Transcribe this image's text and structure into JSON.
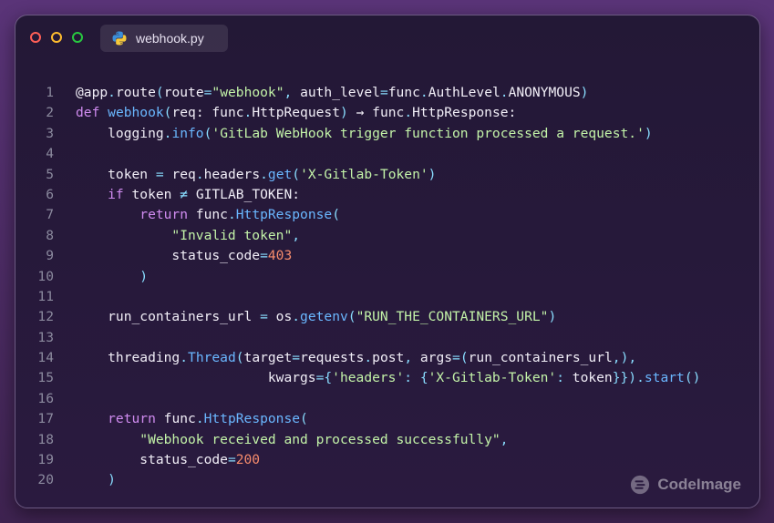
{
  "window": {
    "tab": {
      "icon": "python-icon",
      "filename": "webhook.py"
    }
  },
  "code": {
    "lines": [
      {
        "n": "1",
        "tokens": [
          [
            "t",
            "@app"
          ],
          [
            "o",
            "."
          ],
          [
            "t",
            "route"
          ],
          [
            "o",
            "("
          ],
          [
            "t",
            "route"
          ],
          [
            "o",
            "="
          ],
          [
            "s",
            "\"webhook\""
          ],
          [
            "o",
            ", "
          ],
          [
            "t",
            "auth_level"
          ],
          [
            "o",
            "="
          ],
          [
            "t",
            "func"
          ],
          [
            "o",
            "."
          ],
          [
            "t",
            "AuthLevel"
          ],
          [
            "o",
            "."
          ],
          [
            "t",
            "ANONYMOUS"
          ],
          [
            "o",
            ")"
          ]
        ]
      },
      {
        "n": "2",
        "tokens": [
          [
            "k",
            "def "
          ],
          [
            "f",
            "webhook"
          ],
          [
            "o",
            "("
          ],
          [
            "t",
            "req: func"
          ],
          [
            "o",
            "."
          ],
          [
            "t",
            "HttpRequest"
          ],
          [
            "o",
            ")"
          ],
          [
            "t",
            " → func"
          ],
          [
            "o",
            "."
          ],
          [
            "t",
            "HttpResponse:"
          ]
        ]
      },
      {
        "n": "3",
        "tokens": [
          [
            "t",
            "    logging"
          ],
          [
            "o",
            "."
          ],
          [
            "f",
            "info"
          ],
          [
            "o",
            "("
          ],
          [
            "s",
            "'GitLab WebHook trigger function processed a request.'"
          ],
          [
            "o",
            ")"
          ]
        ]
      },
      {
        "n": "4",
        "tokens": []
      },
      {
        "n": "5",
        "tokens": [
          [
            "t",
            "    token "
          ],
          [
            "o",
            "= "
          ],
          [
            "t",
            "req"
          ],
          [
            "o",
            "."
          ],
          [
            "t",
            "headers"
          ],
          [
            "o",
            "."
          ],
          [
            "f",
            "get"
          ],
          [
            "o",
            "("
          ],
          [
            "s",
            "'X-Gitlab-Token'"
          ],
          [
            "o",
            ")"
          ]
        ]
      },
      {
        "n": "6",
        "tokens": [
          [
            "k",
            "    if "
          ],
          [
            "t",
            "token "
          ],
          [
            "o",
            "≠ "
          ],
          [
            "t",
            "GITLAB_TOKEN:"
          ]
        ]
      },
      {
        "n": "7",
        "tokens": [
          [
            "k",
            "        return "
          ],
          [
            "t",
            "func"
          ],
          [
            "o",
            "."
          ],
          [
            "f",
            "HttpResponse"
          ],
          [
            "o",
            "("
          ]
        ]
      },
      {
        "n": "8",
        "tokens": [
          [
            "s",
            "            \"Invalid token\""
          ],
          [
            "o",
            ","
          ]
        ]
      },
      {
        "n": "9",
        "tokens": [
          [
            "t",
            "            status_code"
          ],
          [
            "o",
            "="
          ],
          [
            "n",
            "403"
          ]
        ]
      },
      {
        "n": "10",
        "tokens": [
          [
            "o",
            "        )"
          ]
        ]
      },
      {
        "n": "11",
        "tokens": []
      },
      {
        "n": "12",
        "tokens": [
          [
            "t",
            "    run_containers_url "
          ],
          [
            "o",
            "= "
          ],
          [
            "t",
            "os"
          ],
          [
            "o",
            "."
          ],
          [
            "f",
            "getenv"
          ],
          [
            "o",
            "("
          ],
          [
            "s",
            "\"RUN_THE_CONTAINERS_URL\""
          ],
          [
            "o",
            ")"
          ]
        ]
      },
      {
        "n": "13",
        "tokens": []
      },
      {
        "n": "14",
        "tokens": [
          [
            "t",
            "    threading"
          ],
          [
            "o",
            "."
          ],
          [
            "f",
            "Thread"
          ],
          [
            "o",
            "("
          ],
          [
            "t",
            "target"
          ],
          [
            "o",
            "="
          ],
          [
            "t",
            "requests"
          ],
          [
            "o",
            "."
          ],
          [
            "t",
            "post"
          ],
          [
            "o",
            ", "
          ],
          [
            "t",
            "args"
          ],
          [
            "o",
            "=("
          ],
          [
            "t",
            "run_containers_url"
          ],
          [
            "o",
            ",),"
          ]
        ]
      },
      {
        "n": "15",
        "tokens": [
          [
            "t",
            "                        kwargs"
          ],
          [
            "o",
            "={"
          ],
          [
            "s",
            "'headers'"
          ],
          [
            "o",
            ": {"
          ],
          [
            "s",
            "'X-Gitlab-Token'"
          ],
          [
            "o",
            ": "
          ],
          [
            "t",
            "token"
          ],
          [
            "o",
            "}})."
          ],
          [
            "f",
            "start"
          ],
          [
            "o",
            "()"
          ]
        ]
      },
      {
        "n": "16",
        "tokens": []
      },
      {
        "n": "17",
        "tokens": [
          [
            "k",
            "    return "
          ],
          [
            "t",
            "func"
          ],
          [
            "o",
            "."
          ],
          [
            "f",
            "HttpResponse"
          ],
          [
            "o",
            "("
          ]
        ]
      },
      {
        "n": "18",
        "tokens": [
          [
            "s",
            "        \"Webhook received and processed successfully\""
          ],
          [
            "o",
            ","
          ]
        ]
      },
      {
        "n": "19",
        "tokens": [
          [
            "t",
            "        status_code"
          ],
          [
            "o",
            "="
          ],
          [
            "n",
            "200"
          ]
        ]
      },
      {
        "n": "20",
        "tokens": [
          [
            "o",
            "    )"
          ]
        ]
      }
    ]
  },
  "watermark": {
    "icon": "codeimage-logo-icon",
    "label": "CodeImage"
  },
  "colors": {
    "keyword": "#d08cf0",
    "function": "#6ab7ff",
    "string": "#c3f3a8",
    "number": "#f78c6c",
    "operator": "#89ddff",
    "text": "#f1eef7",
    "line_number": "#8b8a9e"
  }
}
